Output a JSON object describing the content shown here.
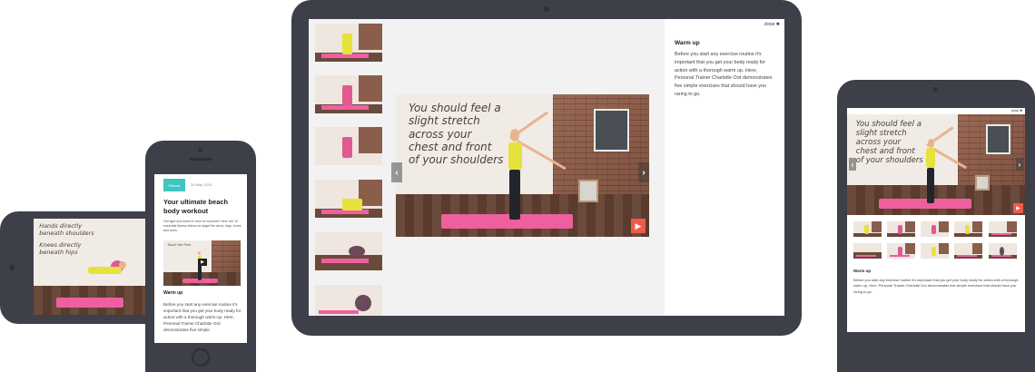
{
  "video": {
    "caption_lines": [
      "You should feel a",
      "slight stretch",
      "across your",
      "chest and front",
      "of your shoulders"
    ],
    "play_icon": "play-icon"
  },
  "panel": {
    "close_label": "close ✖",
    "title": "Warm up",
    "body": "Before you start any exercise routine it's important that you get your body ready for action with a thorough warm up. Here, Personal Trainer Charlotte Ord demonstrates five simple exercises that should have you raring to go."
  },
  "phone": {
    "badge": "Fitness",
    "date": "20 May 2014",
    "title": "Your ultimate beach body workout",
    "intro": "Get light and toned in time for summer! Here are 10 essential fitness videos to target the arms, legs, bums and tums.",
    "video_caption": "Touch the floor",
    "section_title": "Warm up",
    "section_body": "Before you start any exercise routine it's important that you get your body ready for action with a thorough warm-up. Here, Personal Trainer Charlotte Ord demonstrates five simple"
  },
  "landscape_phone": {
    "caption_lines": [
      "Hands directly",
      "beneath shoulders",
      "",
      "Knees directly",
      "beneath hips"
    ]
  },
  "right_tablet": {
    "close_label": "close ✖",
    "title": "Warm up",
    "body": "Before you start any exercise routine it's important that you get your body ready for action with a thorough warm up. Here, Personal Trainer Charlotte Ord demonstrates five simple exercises that should have you raring to go."
  },
  "colors": {
    "device": "#3d3f49",
    "accent_teal": "#40c4c0",
    "play_red": "#ef5a4a",
    "mat_pink": "#ef5fa0"
  }
}
